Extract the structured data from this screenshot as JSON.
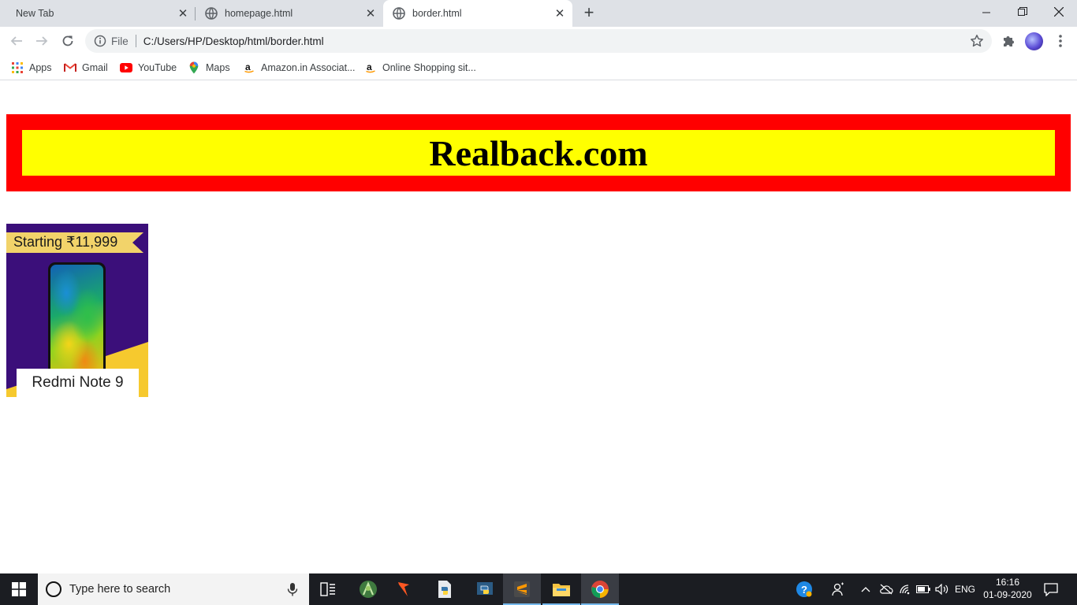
{
  "browser": {
    "tabs": [
      {
        "title": "New Tab",
        "close": "✕"
      },
      {
        "title": "homepage.html",
        "close": "✕"
      },
      {
        "title": "border.html",
        "close": "✕"
      }
    ],
    "new_tab": "+",
    "window_buttons": {
      "minimize": "—",
      "restore": "❐",
      "close": "✕"
    },
    "omnibox": {
      "scheme_label": "File",
      "url": "C:/Users/HP/Desktop/html/border.html"
    },
    "bookmarks": [
      {
        "label": "Apps",
        "icon": "apps-grid-icon"
      },
      {
        "label": "Gmail",
        "icon": "gmail-icon"
      },
      {
        "label": "YouTube",
        "icon": "youtube-icon"
      },
      {
        "label": "Maps",
        "icon": "maps-pin-icon"
      },
      {
        "label": "Amazon.in Associat...",
        "icon": "amazon-icon"
      },
      {
        "label": "Online Shopping sit...",
        "icon": "amazon-icon"
      }
    ]
  },
  "page": {
    "banner_title": "Realback.com",
    "banner_colors": {
      "outer": "#ff0000",
      "inner": "#ffff00"
    },
    "product": {
      "price_ribbon": "Starting ₹11,999",
      "name": "Redmi Note 9"
    }
  },
  "taskbar": {
    "search_placeholder": "Type here to search",
    "language": "ENG",
    "time": "16:16",
    "date": "01-09-2020"
  }
}
